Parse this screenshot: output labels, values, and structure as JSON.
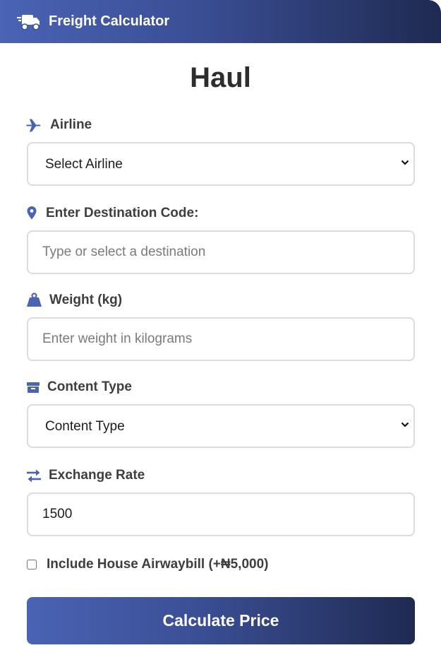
{
  "header": {
    "title": "Freight Calculator",
    "icon": "truck-fast-icon"
  },
  "page": {
    "title": "Haul"
  },
  "colors": {
    "brand_start": "#4a63b4",
    "brand_end": "#1f2a52",
    "icon_accent": "#4a63b4"
  },
  "form": {
    "airline": {
      "label": "Airline",
      "icon": "plane-icon",
      "selected": "Select Airline"
    },
    "destination": {
      "label": "Enter Destination Code:",
      "icon": "map-pin-icon",
      "placeholder": "Type or select a destination",
      "value": ""
    },
    "weight": {
      "label": "Weight (kg)",
      "icon": "weight-icon",
      "placeholder": "Enter weight in kilograms",
      "value": ""
    },
    "content_type": {
      "label": "Content Type",
      "icon": "box-icon",
      "selected": "Content Type"
    },
    "exchange_rate": {
      "label": "Exchange Rate",
      "icon": "exchange-arrows-icon",
      "value": "1500"
    },
    "house_airwaybill": {
      "label": "Include House Airwaybill (+₦5,000)",
      "checked": false
    },
    "submit_label": "Calculate Price"
  }
}
